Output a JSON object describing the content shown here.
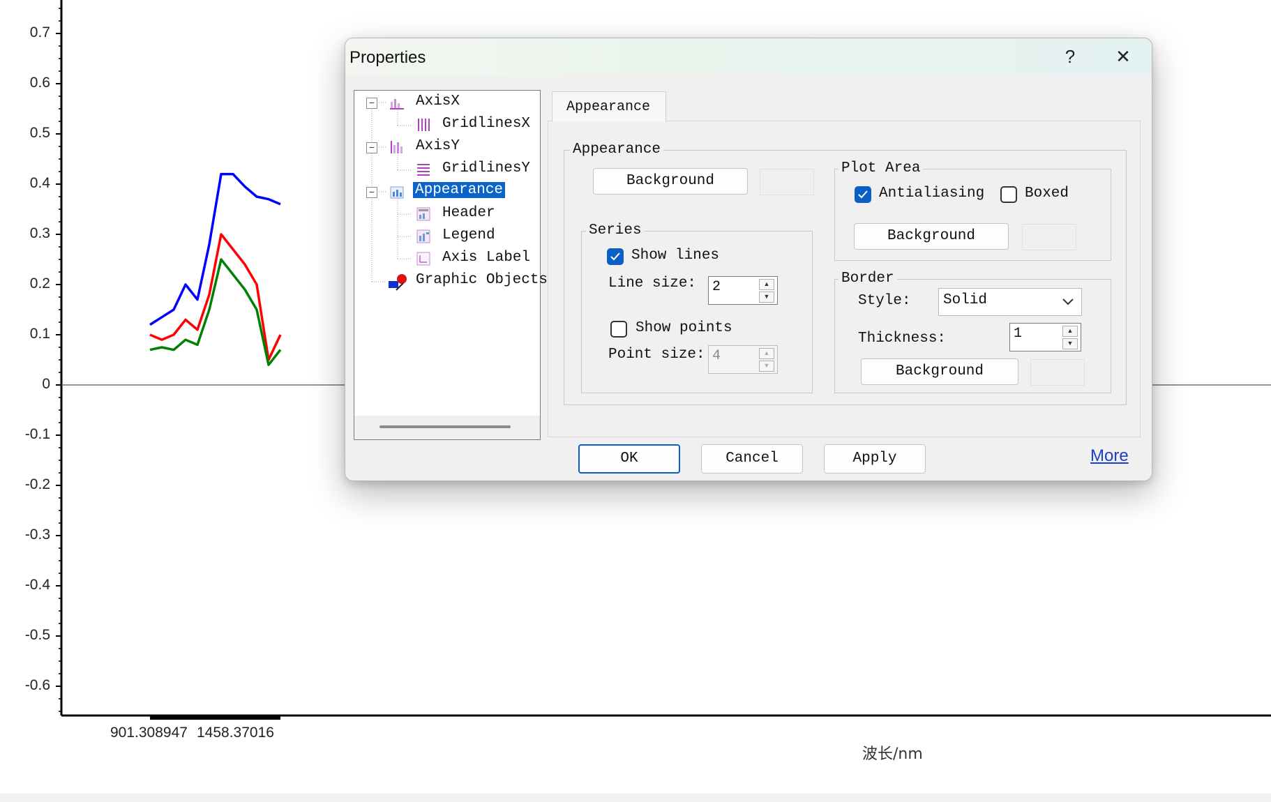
{
  "chart_data": {
    "type": "line",
    "title": "",
    "xlabel": "波长/nm",
    "ylabel": "",
    "ylim": [
      -0.65,
      0.76
    ],
    "y_ticks": [
      "0.7",
      "0.6",
      "0.5",
      "0.4",
      "0.3",
      "0.2",
      "0.1",
      "0",
      "-0.1",
      "-0.2",
      "-0.3",
      "-0.4",
      "-0.5",
      "-0.6"
    ],
    "x_ticks": [
      "901.308947",
      "1458.37016"
    ],
    "xlim": [
      901.308947,
      1458.37016
    ],
    "x": [
      901.31,
      951.95,
      1002.6,
      1053.24,
      1103.88,
      1154.53,
      1205.17,
      1255.81,
      1306.46,
      1357.1,
      1407.74,
      1458.37
    ],
    "series": [
      {
        "values": [
          0.12,
          0.135,
          0.15,
          0.2,
          0.17,
          0.28,
          0.42,
          0.42,
          0.395,
          0.375,
          0.37,
          0.36
        ]
      },
      {
        "values": [
          0.1,
          0.09,
          0.1,
          0.13,
          0.11,
          0.18,
          0.3,
          0.27,
          0.24,
          0.2,
          0.05,
          0.1
        ]
      },
      {
        "values": [
          0.07,
          0.075,
          0.07,
          0.09,
          0.08,
          0.15,
          0.25,
          0.22,
          0.19,
          0.15,
          0.04,
          0.07
        ]
      }
    ],
    "series_colors": [
      "#0000ff",
      "#ff0000",
      "#008000"
    ],
    "grid": false
  },
  "dialog": {
    "title": "Properties",
    "help_glyph": "?",
    "close_glyph": "✕",
    "tree": [
      {
        "label": "AxisX"
      },
      {
        "label": "GridlinesX"
      },
      {
        "label": "AxisY"
      },
      {
        "label": "GridlinesY"
      },
      {
        "label": "Appearance"
      },
      {
        "label": "Header"
      },
      {
        "label": "Legend"
      },
      {
        "label": "Axis Label"
      },
      {
        "label": "Graphic Objects"
      }
    ],
    "tab": "Appearance",
    "appearance_group": {
      "label": "Appearance",
      "background_button": "Background"
    },
    "series_group": {
      "label": "Series",
      "show_lines": "Show lines",
      "show_lines_checked": true,
      "line_size_label": "Line size:",
      "line_size": "2",
      "show_points": "Show points",
      "show_points_checked": false,
      "point_size_label": "Point size:",
      "point_size": "4"
    },
    "plot_area_group": {
      "label": "Plot Area",
      "antialiasing": "Antialiasing",
      "antialiasing_checked": true,
      "boxed": "Boxed",
      "boxed_checked": false,
      "background_button": "Background"
    },
    "border_group": {
      "label": "Border",
      "style_label": "Style:",
      "style_value": "Solid",
      "thickness_label": "Thickness:",
      "thickness": "1",
      "background_button": "Background"
    },
    "buttons": {
      "ok": "OK",
      "cancel": "Cancel",
      "apply": "Apply",
      "more": "More"
    }
  }
}
